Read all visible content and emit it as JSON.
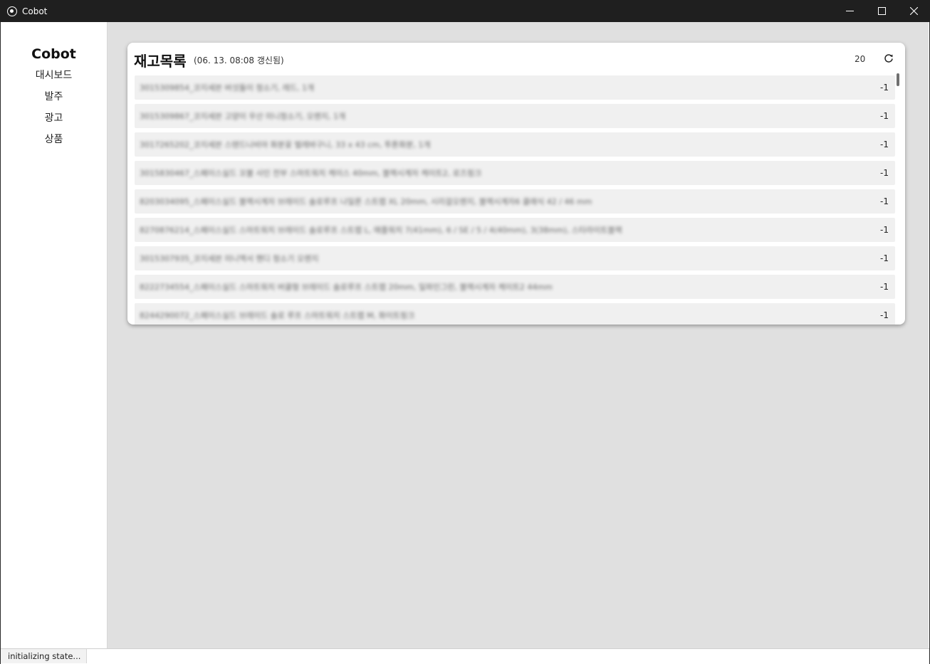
{
  "window": {
    "title": "Cobot"
  },
  "sidebar": {
    "brand": "Cobot",
    "items": [
      {
        "label": "대시보드"
      },
      {
        "label": "발주"
      },
      {
        "label": "광고"
      },
      {
        "label": "상품"
      }
    ]
  },
  "card": {
    "title": "재고목록",
    "subtitle": "(06. 13. 08:08 갱신됨)",
    "count": "20",
    "rows": [
      {
        "name": "3015309854_코지세븐 버섯돌이 청소기, 레드, 1개",
        "value": "-1"
      },
      {
        "name": "3015309867_코지세븐 고양이 우산 미니청소기, 오렌지, 1개",
        "value": "-1"
      },
      {
        "name": "3017265202_코지세븐 스탠드나비야 화분꽂 벌레바구니, 33 x 43 cm, 투톤화분, 1개",
        "value": "-1"
      },
      {
        "name": "3015830467_스페이스실드 꼬불 사인 전부 스마트워치 케이스 40mm, 블랙시계자 케이트2, 로즈핑크",
        "value": "-1"
      },
      {
        "name": "8203034095_스페이스실드 블랙시계자 브레이드 솔로루프 나일론 스트랩 XL 20mm, 시리걸오렌지, 블랙시계자6 클래식 42 / 46 mm",
        "value": "-1"
      },
      {
        "name": "8270876214_스페이스실드 스마트워치 브레이드 솔로루프 스트랩 L, 애플워치 7(41mm), 6 / SE / 5 / 4(40mm), 3(38mm), 스타라이트블랙",
        "value": "-1"
      },
      {
        "name": "3015307935_코지세븐 미니액서 핸디 청소기 오렌지",
        "value": "-1"
      },
      {
        "name": "8222734554_스페이스실드 스마트워치 버클형 브레이드 솔로루프 스트랩 20mm, 일파인그린, 블랙시계자 케이트2 44mm",
        "value": "-1"
      },
      {
        "name": "8244290072_스페이스실드 브레이드 솔로 루프 스마트워치 스트랩 M, 화이트핑크",
        "value": "-1"
      }
    ]
  },
  "status": {
    "text": "initializing state..."
  },
  "icons": {
    "app": "globe-icon",
    "refresh": "refresh-icon"
  }
}
